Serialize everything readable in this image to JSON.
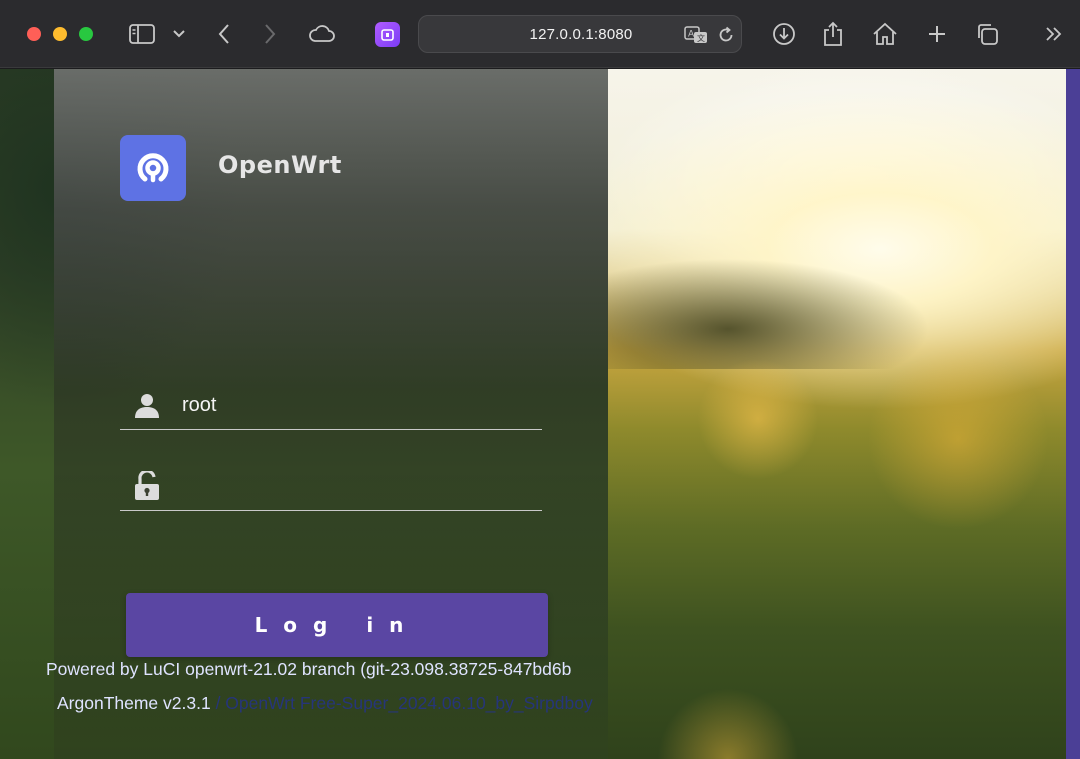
{
  "browser": {
    "url": "127.0.0.1:8080",
    "icons": [
      "sidebar-icon",
      "chevron-down-icon",
      "back-icon",
      "forward-icon",
      "icloud-icon",
      "extension-icon",
      "translate-icon",
      "reload-icon",
      "download-icon",
      "share-icon",
      "home-icon",
      "new-tab-icon",
      "tabs-overview-icon",
      "more-icon"
    ]
  },
  "login": {
    "brand": "OpenWrt",
    "username_value": "root",
    "password_value": "",
    "button_label": "Log in",
    "logo_icon": "openwrt-logo-icon",
    "user_icon": "user-icon",
    "lock_icon": "lock-icon"
  },
  "footer": {
    "line1": "Powered by LuCI openwrt-21.02 branch (git-23.098.38725-847bd6b",
    "theme": "ArgonTheme v2.3.1",
    "build": " / OpenWrt Free-Super_2024.06.10_by_Sirpdboy"
  },
  "colors": {
    "accent": "#5a46a3",
    "logo_bg": "#5e72e4",
    "footer_text": "#dfe3ff",
    "footer_build": "#26357a"
  }
}
